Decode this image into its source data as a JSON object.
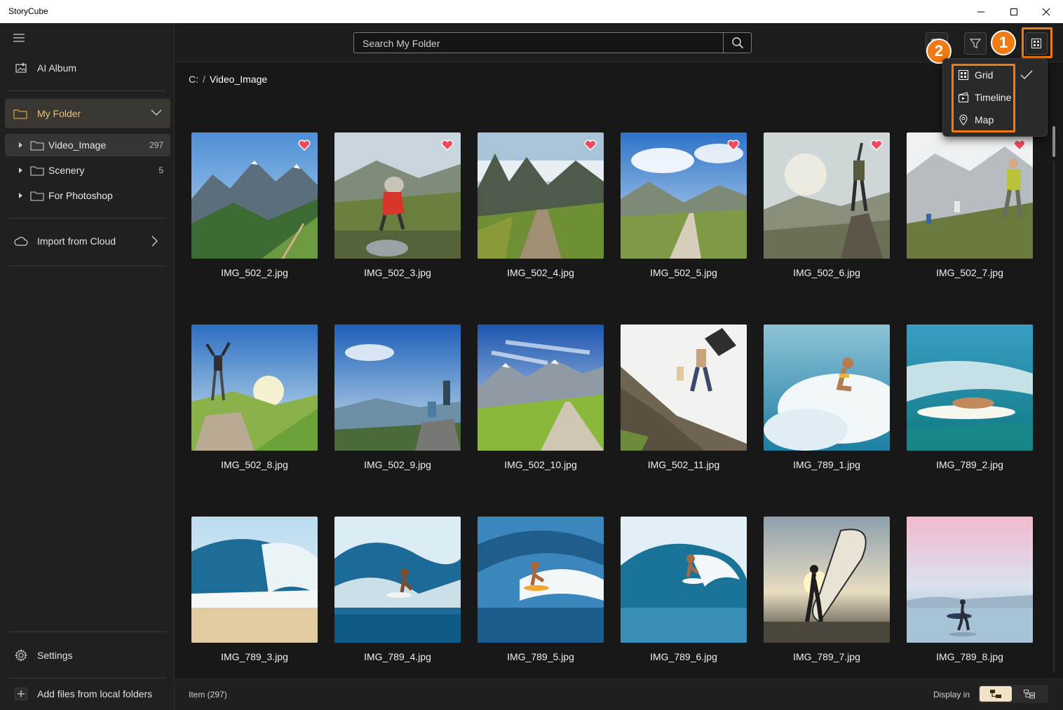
{
  "app": {
    "title": "StoryCube"
  },
  "sidebar": {
    "ai_album": "AI Album",
    "my_folder": "My Folder",
    "folders": [
      {
        "name": "Video_Image",
        "count": "297"
      },
      {
        "name": "Scenery",
        "count": "5"
      },
      {
        "name": "For Photoshop",
        "count": ""
      }
    ],
    "import_cloud": "Import from Cloud",
    "settings": "Settings",
    "add_files": "Add files from local folders"
  },
  "search": {
    "placeholder": "Search My Folder"
  },
  "breadcrumb": {
    "root": "C:",
    "separator": "/",
    "current": "Video_Image"
  },
  "view_menu": {
    "items": [
      {
        "label": "Grid",
        "icon": "grid-icon",
        "checked": true
      },
      {
        "label": "Timeline",
        "icon": "timeline-icon",
        "checked": false
      },
      {
        "label": "Map",
        "icon": "map-pin-icon",
        "checked": false
      }
    ]
  },
  "annotations": {
    "badge1": "1",
    "badge2": "2",
    "highlight_color": "#f07b13"
  },
  "photos": [
    {
      "name": "IMG_502_2.jpg",
      "favorite": true,
      "scene": "mountains"
    },
    {
      "name": "IMG_502_3.jpg",
      "favorite": true,
      "scene": "hiker-bag"
    },
    {
      "name": "IMG_502_4.jpg",
      "favorite": true,
      "scene": "trail-peaks"
    },
    {
      "name": "IMG_502_5.jpg",
      "favorite": true,
      "scene": "valley-road"
    },
    {
      "name": "IMG_502_6.jpg",
      "favorite": true,
      "scene": "hiker-rock"
    },
    {
      "name": "IMG_502_7.jpg",
      "favorite": true,
      "scene": "hikers-group"
    },
    {
      "name": "IMG_502_8.jpg",
      "favorite": false,
      "scene": "summit-arms"
    },
    {
      "name": "IMG_502_9.jpg",
      "favorite": false,
      "scene": "couple-rock"
    },
    {
      "name": "IMG_502_10.jpg",
      "favorite": false,
      "scene": "alpine-path"
    },
    {
      "name": "IMG_502_11.jpg",
      "favorite": false,
      "scene": "climbers"
    },
    {
      "name": "IMG_789_1.jpg",
      "favorite": false,
      "scene": "splash"
    },
    {
      "name": "IMG_789_2.jpg",
      "favorite": false,
      "scene": "surfboard-lying"
    },
    {
      "name": "IMG_789_3.jpg",
      "favorite": false,
      "scene": "wave-beach"
    },
    {
      "name": "IMG_789_4.jpg",
      "favorite": false,
      "scene": "surfer-wave"
    },
    {
      "name": "IMG_789_5.jpg",
      "favorite": false,
      "scene": "surfer-blue"
    },
    {
      "name": "IMG_789_6.jpg",
      "favorite": false,
      "scene": "surfer-curl"
    },
    {
      "name": "IMG_789_7.jpg",
      "favorite": false,
      "scene": "sunset-surfer"
    },
    {
      "name": "IMG_789_8.jpg",
      "favorite": false,
      "scene": "pastel-surfer"
    }
  ],
  "footer": {
    "item_count": "Item (297)",
    "display_in": "Display in"
  }
}
